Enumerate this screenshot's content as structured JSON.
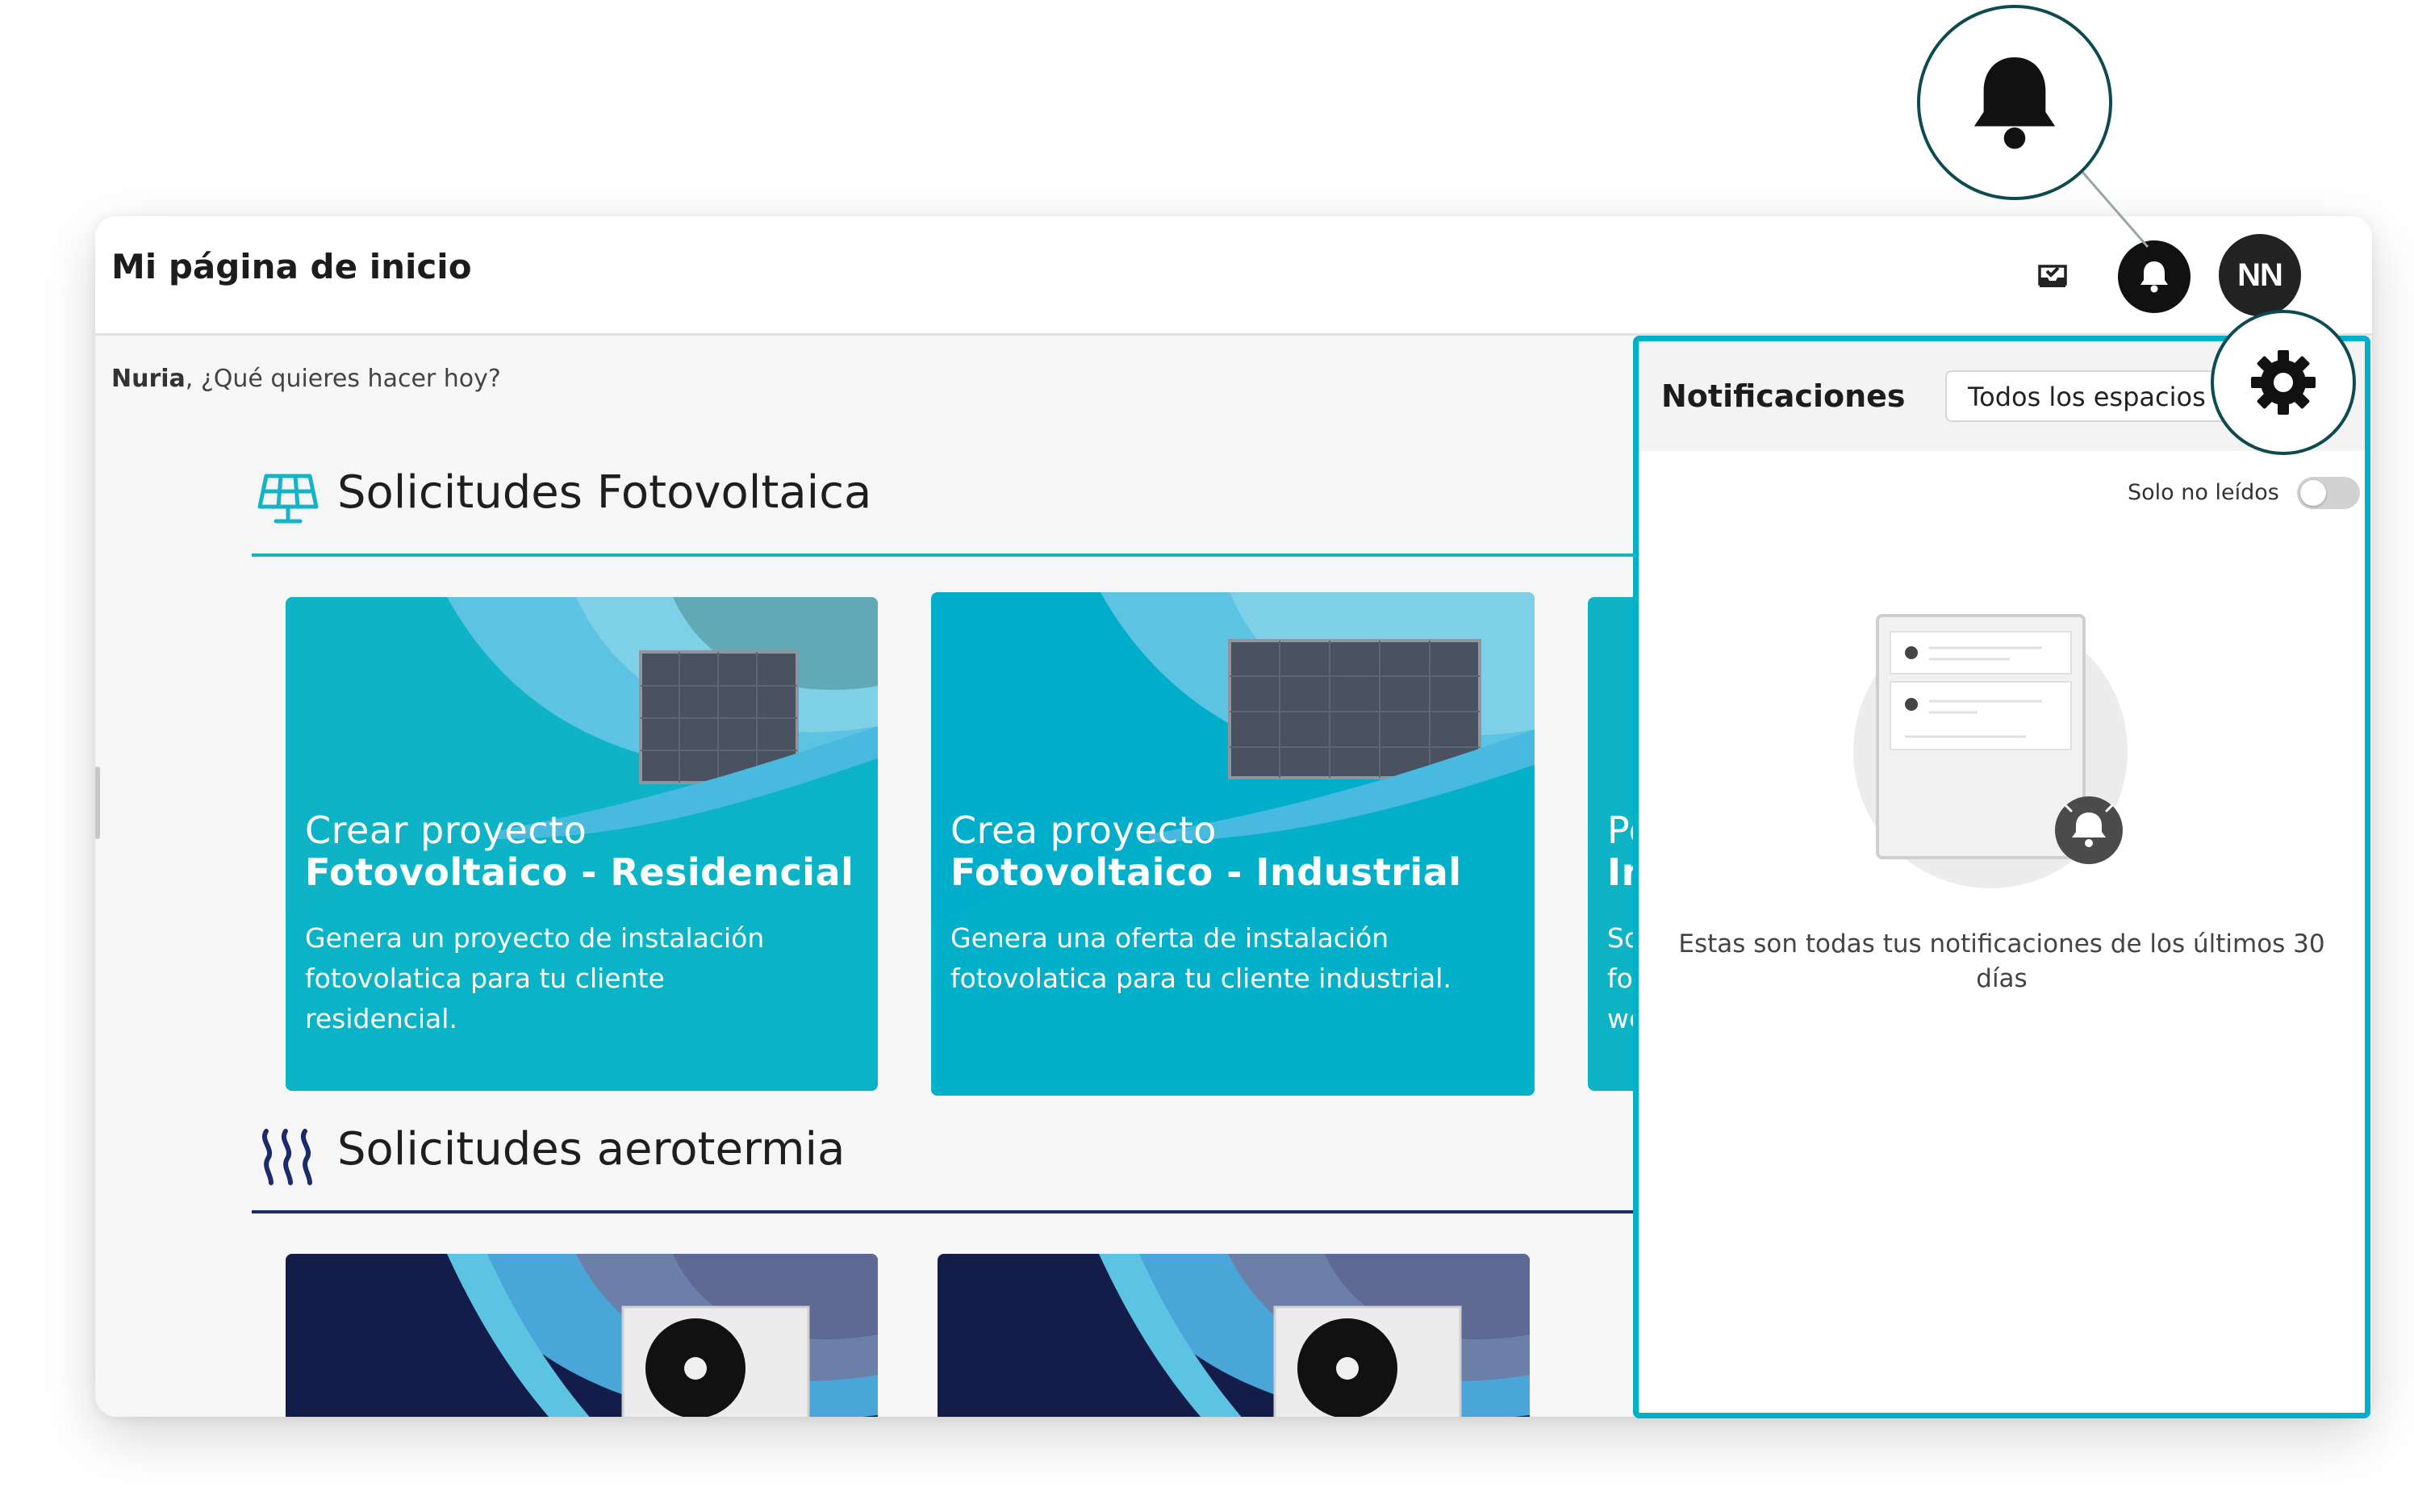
{
  "header": {
    "title": "Mi página de inicio",
    "avatar_initials": "NN"
  },
  "greeting": {
    "name": "Nuria",
    "text": ", ¿Qué quieres hacer hoy?"
  },
  "sections": [
    {
      "title": "Solicitudes Fotovoltaica",
      "icon": "solar-panel-icon",
      "rule_color": "#14b3c8",
      "cards": [
        {
          "title_light": "Crear proyecto",
          "title_bold": "Fotovoltaico - Residencial",
          "description": "Genera un proyecto de instalación fotovolatica para tu cliente residencial."
        },
        {
          "title_light": "Crea proyecto",
          "title_bold": "Fotovoltaico - Industrial",
          "description": "Genera una oferta de instalación fotovolatica para tu cliente industrial."
        },
        {
          "title_light": "Pet",
          "title_bold": "Ins",
          "description_lines": [
            "Solic",
            "fotov",
            "web"
          ]
        }
      ]
    },
    {
      "title": "Solicitudes aerotermia",
      "icon": "heat-waves-icon",
      "rule_color": "#1b2a6b"
    }
  ],
  "notifications": {
    "title": "Notificaciones",
    "space_filter": "Todos los espacios",
    "unread_only_label": "Solo no leídos",
    "unread_only": false,
    "empty_message": "Estas son todas tus notificaciones de los últimos 30 días"
  },
  "colors": {
    "accent": "#00b0c9",
    "card_teal": "#0fb3c6",
    "card_navy": "#141c4a",
    "highlight_ring": "#0e4a52"
  }
}
